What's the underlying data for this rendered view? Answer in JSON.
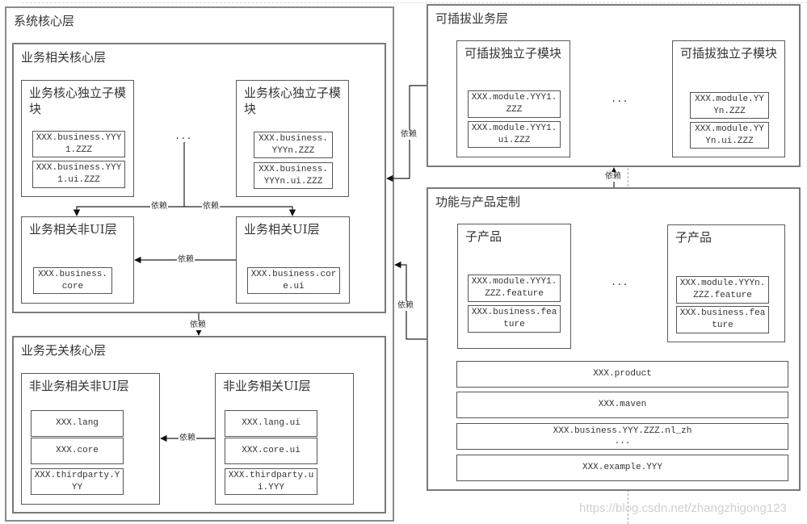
{
  "system_core": {
    "title": "系统核心层",
    "business_core": {
      "title": "业务相关核心层",
      "submodules": [
        {
          "title": "业务核心独立子模块",
          "packages": [
            "XXX.business.YYY1.ZZZ",
            "XXX.business.YYY1.ui.ZZZ"
          ]
        },
        {
          "title": "业务核心独立子模块",
          "packages": [
            "XXX.business.YYYn.ZZZ",
            "XXX.business.YYYn.ui.ZZZ"
          ]
        }
      ],
      "ellipsis": "...",
      "non_ui_layer": {
        "title": "业务相关非UI层",
        "packages": [
          "XXX.business.core"
        ]
      },
      "ui_layer": {
        "title": "业务相关UI层",
        "packages": [
          "XXX.business.core.ui"
        ]
      }
    },
    "non_business_core": {
      "title": "业务无关核心层",
      "non_ui_layer": {
        "title": "非业务相关非UI层",
        "packages": [
          "XXX.lang",
          "XXX.core",
          "XXX.thirdparty.YYY"
        ]
      },
      "ui_layer": {
        "title": "非业务相关UI层",
        "packages": [
          "XXX.lang.ui",
          "XXX.core.ui",
          "XXX.thirdparty.ui.YYY"
        ]
      }
    }
  },
  "pluggable_business": {
    "title": "可插拔业务层",
    "submodules": [
      {
        "title": "可插拔独立子模块",
        "packages": [
          "XXX.module.YYY1.ZZZ",
          "XXX.module.YYY1.ui.ZZZ"
        ]
      },
      {
        "title": "可插拔独立子模块",
        "packages": [
          "XXX.module.YYYn.ZZZ",
          "XXX.module.YYYn.ui.ZZZ"
        ]
      }
    ],
    "ellipsis": "..."
  },
  "feature_product": {
    "title": "功能与产品定制",
    "subproducts": [
      {
        "title": "子产品",
        "packages": [
          "XXX.module.YYY1.ZZZ.feature",
          "XXX.business.feature"
        ]
      },
      {
        "title": "子产品",
        "packages": [
          "XXX.module.YYYn.ZZZ.feature",
          "XXX.business.feature"
        ]
      }
    ],
    "ellipsis": "...",
    "packages": [
      "XXX.product",
      "XXX.maven",
      "XXX.business.YYY.ZZZ.nl_zh\n...",
      "XXX.example.YYY"
    ]
  },
  "dependency_label": "依赖",
  "watermark": "https://blog.csdn.net/zhangzhigong123"
}
